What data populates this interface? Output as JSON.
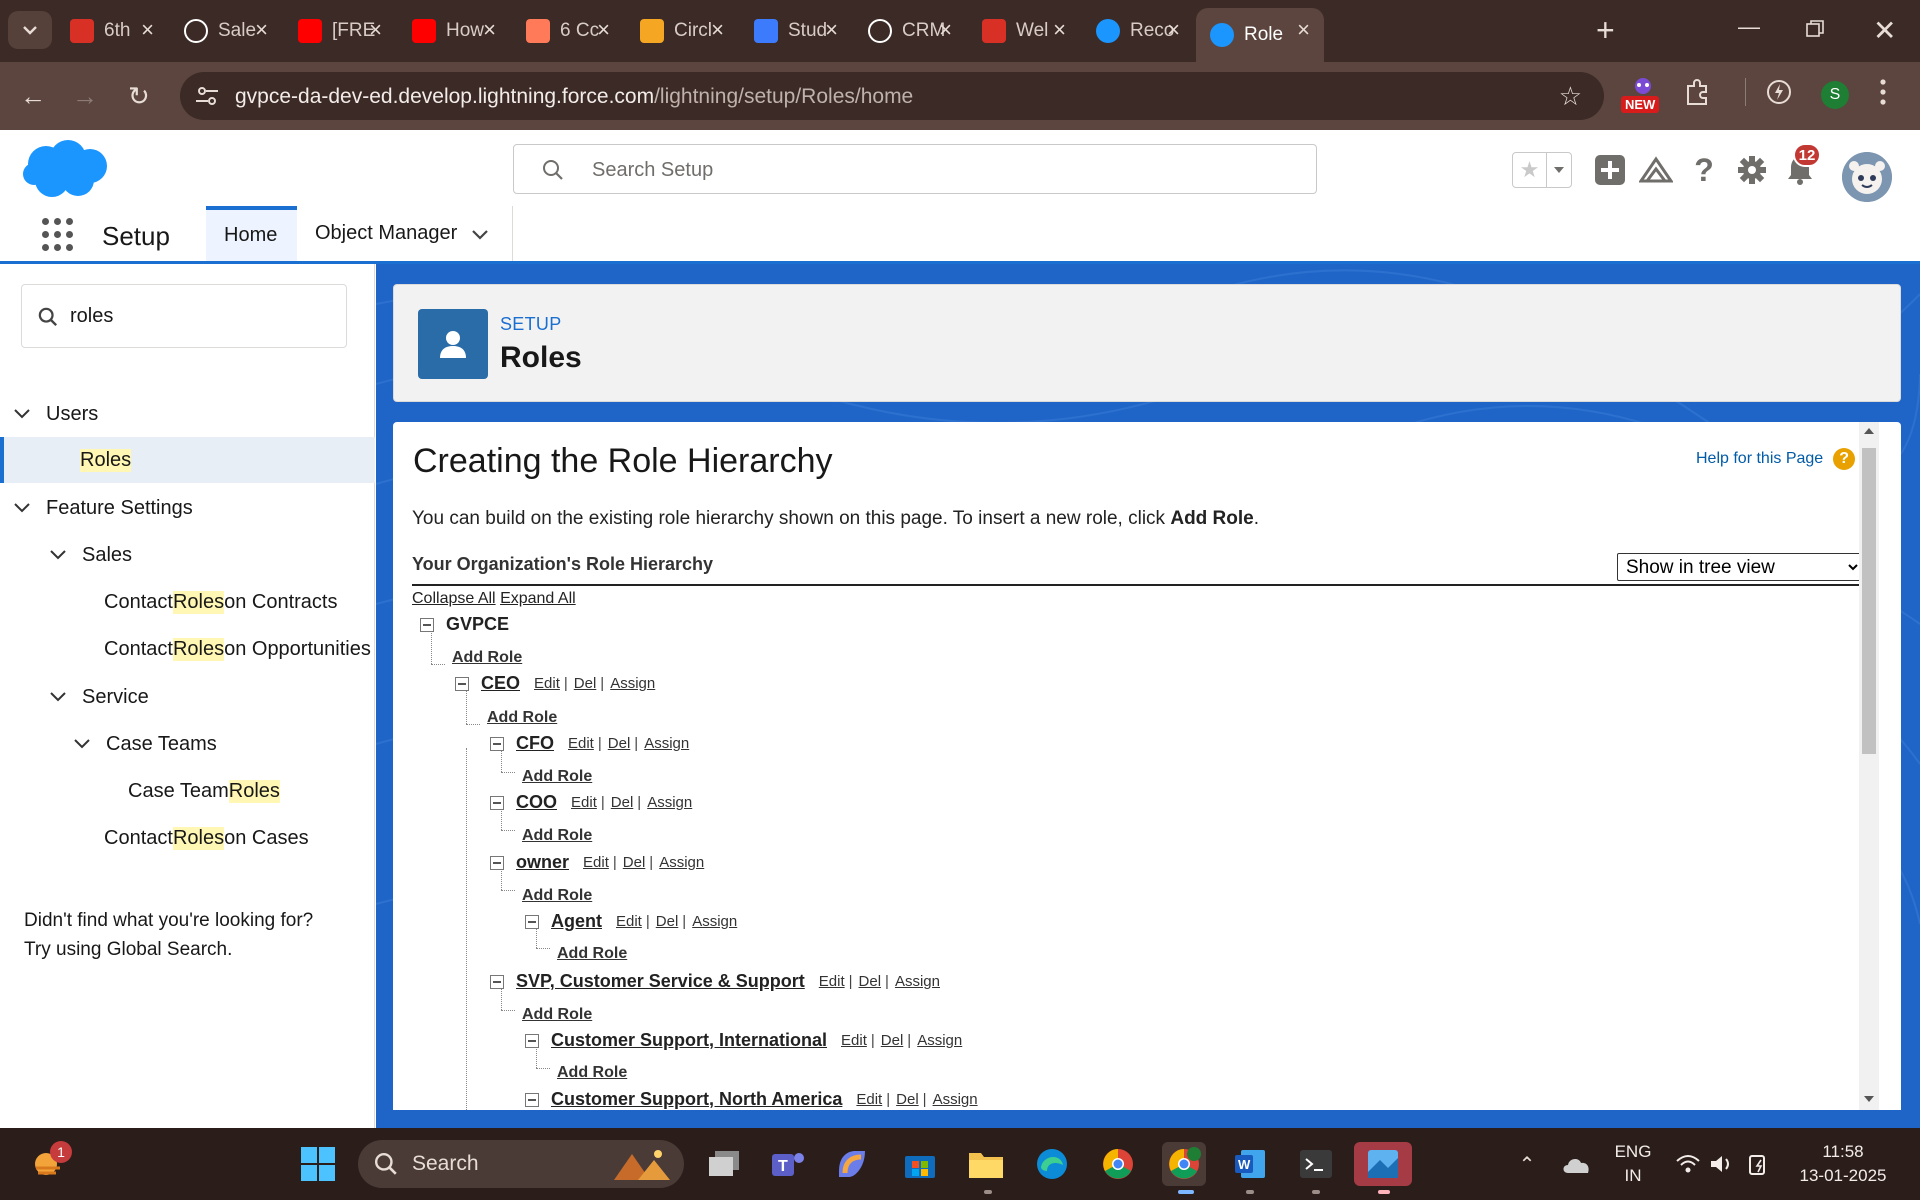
{
  "browser": {
    "tabs": [
      {
        "title": "6th",
        "icon": "gmail-icon",
        "color": "#d93025",
        "active": false
      },
      {
        "title": "Sale",
        "icon": "chatgpt-icon",
        "color": "#ffffff",
        "active": false
      },
      {
        "title": "[FRE",
        "icon": "youtube-icon",
        "color": "#ff0000",
        "active": false
      },
      {
        "title": "How",
        "icon": "youtube-icon",
        "color": "#ff0000",
        "active": false
      },
      {
        "title": "6 Cc",
        "icon": "hubspot-icon",
        "color": "#ff7a59",
        "active": false
      },
      {
        "title": "Circl",
        "icon": "circle-icon",
        "color": "#f5a623",
        "active": false
      },
      {
        "title": "Stud",
        "icon": "studio-icon",
        "color": "#3d7bfd",
        "active": false
      },
      {
        "title": "CRM",
        "icon": "github-icon",
        "color": "#ffffff",
        "active": false
      },
      {
        "title": "Wel",
        "icon": "gmail-icon",
        "color": "#d93025",
        "active": false
      },
      {
        "title": "Reco",
        "icon": "salesforce-icon",
        "color": "#1b96ff",
        "active": false
      },
      {
        "title": "Role",
        "icon": "salesforce-icon",
        "color": "#1b96ff",
        "active": true
      }
    ],
    "url_host": "gvpce-da-dev-ed.develop.lightning.force.com",
    "url_path": "/lightning/setup/Roles/home",
    "new_badge": "NEW",
    "profile_initial": "S"
  },
  "header": {
    "search_placeholder": "Search Setup",
    "notification_count": "12"
  },
  "nav": {
    "app_name": "Setup",
    "tabs": [
      {
        "label": "Home",
        "active": true
      },
      {
        "label": "Object Manager",
        "active": false
      }
    ]
  },
  "sidebar": {
    "quick_find_value": "roles",
    "items": {
      "users": "Users",
      "roles_hl": "Roles",
      "feature_settings": "Feature Settings",
      "sales": "Sales",
      "contact_contracts_pre": "Contact ",
      "contact_contracts_post": " on Contracts",
      "contact_opps_pre": "Contact ",
      "contact_opps_post": " on Opportunities",
      "service": "Service",
      "case_teams": "Case Teams",
      "case_team_pre": "Case Team ",
      "contact_cases_pre": "Contact ",
      "contact_cases_post": " on Cases"
    },
    "highlight_word": "Roles",
    "help_line1": "Didn't find what you're looking for?",
    "help_line2": "Try using Global Search."
  },
  "page_header": {
    "breadcrumb": "SETUP",
    "title": "Roles"
  },
  "content": {
    "heading": "Creating the Role Hierarchy",
    "help_link": "Help for this Page",
    "intro_text": "You can build on the existing role hierarchy shown on this page. To insert a new role, click ",
    "intro_bold": "Add Role",
    "intro_end": ".",
    "section_title": "Your Organization's Role Hierarchy",
    "view_options": [
      "Show in tree view"
    ],
    "view_selected": "Show in tree view",
    "collapse_all": "Collapse All",
    "expand_all": "Expand All",
    "add_role": "Add Role",
    "actions": {
      "edit": "Edit",
      "del": "Del",
      "assign": "Assign",
      "sep": "|"
    },
    "roles": {
      "root": "GVPCE",
      "ceo": "CEO",
      "cfo": "CFO",
      "coo": "COO",
      "owner": "owner",
      "agent": "Agent",
      "svp": "SVP, Customer Service & Support",
      "csi": "Customer Support, International",
      "csna": "Customer Support, North America"
    }
  },
  "taskbar": {
    "search_label": "Search",
    "weather_badge": "1",
    "lang_line1": "ENG",
    "lang_line2": "IN",
    "time": "11:58",
    "date": "13-01-2025"
  }
}
